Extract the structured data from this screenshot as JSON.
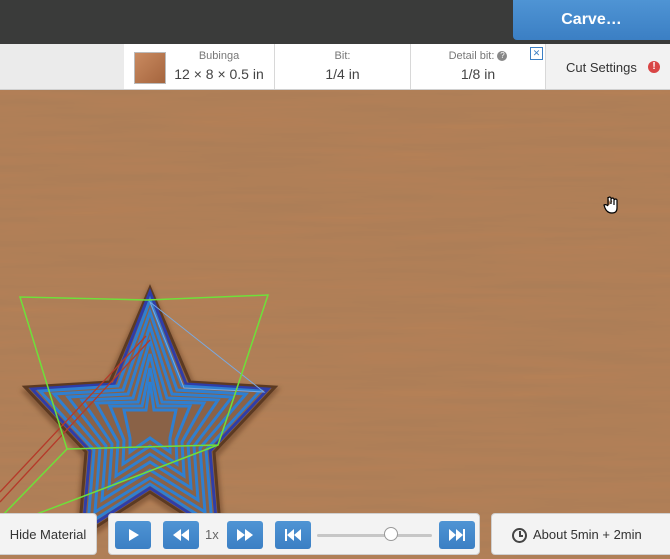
{
  "toolbar": {
    "carve_label": "Carve…"
  },
  "material": {
    "name": "Bubinga",
    "dimensions": "12 × 8 × 0.5 in"
  },
  "bit": {
    "label": "Bit:",
    "value": "1/4 in"
  },
  "detail_bit": {
    "label": "Detail bit:",
    "value": "1/8 in"
  },
  "cut_settings": {
    "label": "Cut Settings"
  },
  "bottom": {
    "hide_material_label": "Hide Material",
    "speed_label": "1x",
    "slider_position": 0.64,
    "estimate": "About 5min + 2min"
  },
  "colors": {
    "accent": "#3b7fc4",
    "wood": "#b07a4e",
    "toolpath": "#2f7fd0",
    "outline": "#6ee03a",
    "warning": "#d94545"
  },
  "icons": [
    "help-icon",
    "close-icon",
    "warning-icon",
    "play-icon",
    "rewind-icon",
    "fast-forward-icon",
    "skip-back-icon",
    "skip-forward-icon",
    "clock-icon",
    "hand-cursor-icon"
  ]
}
